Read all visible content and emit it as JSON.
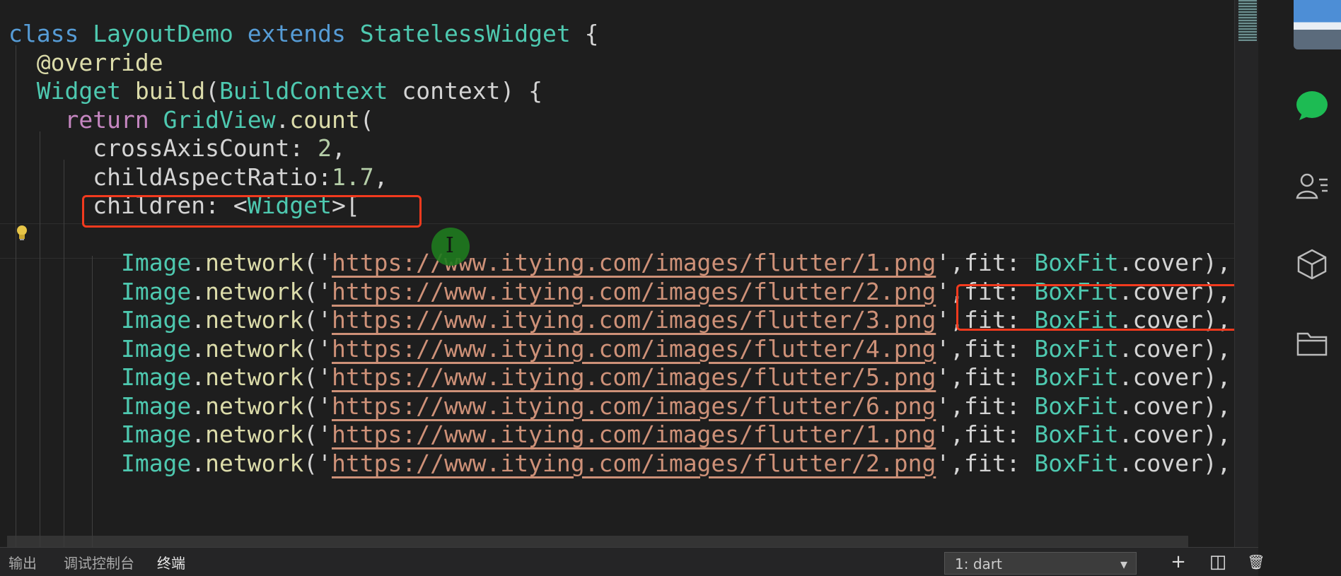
{
  "editor": {
    "lines": [
      {
        "tokens": [
          [
            "kw",
            "class"
          ],
          [
            "pl",
            " "
          ],
          [
            "ty",
            "LayoutDemo"
          ],
          [
            "pl",
            " "
          ],
          [
            "kw",
            "extends"
          ],
          [
            "pl",
            " "
          ],
          [
            "ty",
            "StatelessWidget"
          ],
          [
            "pl",
            " {"
          ]
        ]
      },
      {
        "tokens": [
          [
            "pl",
            "  "
          ],
          [
            "ann",
            "@override"
          ]
        ]
      },
      {
        "tokens": [
          [
            "pl",
            "  "
          ],
          [
            "ty",
            "Widget"
          ],
          [
            "pl",
            " "
          ],
          [
            "fn",
            "build"
          ],
          [
            "pl",
            "("
          ],
          [
            "ty",
            "BuildContext"
          ],
          [
            "pl",
            " context) {"
          ]
        ]
      },
      {
        "tokens": [
          [
            "pl",
            "    "
          ],
          [
            "kw2",
            "return"
          ],
          [
            "pl",
            " "
          ],
          [
            "ty",
            "GridView"
          ],
          [
            "pl",
            "."
          ],
          [
            "fn",
            "count"
          ],
          [
            "pl",
            "("
          ]
        ]
      },
      {
        "tokens": [
          [
            "pl",
            "      crossAxisCount: "
          ],
          [
            "nu",
            "2"
          ],
          [
            "pl",
            ","
          ]
        ]
      },
      {
        "tokens": [
          [
            "pl",
            "      childAspectRatio:"
          ],
          [
            "nu",
            "1.7"
          ],
          [
            "pl",
            ","
          ]
        ]
      },
      {
        "tokens": [
          [
            "pl",
            "      children: <"
          ],
          [
            "ty",
            "Widget"
          ],
          [
            "pl",
            ">["
          ]
        ]
      },
      {
        "tokens": [
          [
            "pl",
            ""
          ]
        ]
      },
      {
        "tokens": [
          [
            "pl",
            "        "
          ],
          [
            "ty",
            "Image"
          ],
          [
            "pl",
            "."
          ],
          [
            "fn",
            "network"
          ],
          [
            "pl",
            "('"
          ],
          [
            "st",
            "https://www.itying.com/images/flutter/1.png"
          ],
          [
            "pl",
            "',fit: "
          ],
          [
            "ty",
            "BoxFit"
          ],
          [
            "pl",
            ".cover),"
          ]
        ]
      },
      {
        "tokens": [
          [
            "pl",
            "        "
          ],
          [
            "ty",
            "Image"
          ],
          [
            "pl",
            "."
          ],
          [
            "fn",
            "network"
          ],
          [
            "pl",
            "('"
          ],
          [
            "st",
            "https://www.itying.com/images/flutter/2.png"
          ],
          [
            "pl",
            "',fit: "
          ],
          [
            "ty",
            "BoxFit"
          ],
          [
            "pl",
            ".cover),"
          ]
        ]
      },
      {
        "tokens": [
          [
            "pl",
            "        "
          ],
          [
            "ty",
            "Image"
          ],
          [
            "pl",
            "."
          ],
          [
            "fn",
            "network"
          ],
          [
            "pl",
            "('"
          ],
          [
            "st",
            "https://www.itying.com/images/flutter/3.png"
          ],
          [
            "pl",
            "',fit: "
          ],
          [
            "ty",
            "BoxFit"
          ],
          [
            "pl",
            ".cover),"
          ]
        ]
      },
      {
        "tokens": [
          [
            "pl",
            "        "
          ],
          [
            "ty",
            "Image"
          ],
          [
            "pl",
            "."
          ],
          [
            "fn",
            "network"
          ],
          [
            "pl",
            "('"
          ],
          [
            "st",
            "https://www.itying.com/images/flutter/4.png"
          ],
          [
            "pl",
            "',fit: "
          ],
          [
            "ty",
            "BoxFit"
          ],
          [
            "pl",
            ".cover),"
          ]
        ]
      },
      {
        "tokens": [
          [
            "pl",
            "        "
          ],
          [
            "ty",
            "Image"
          ],
          [
            "pl",
            "."
          ],
          [
            "fn",
            "network"
          ],
          [
            "pl",
            "('"
          ],
          [
            "st",
            "https://www.itying.com/images/flutter/5.png"
          ],
          [
            "pl",
            "',fit: "
          ],
          [
            "ty",
            "BoxFit"
          ],
          [
            "pl",
            ".cover),"
          ]
        ]
      },
      {
        "tokens": [
          [
            "pl",
            "        "
          ],
          [
            "ty",
            "Image"
          ],
          [
            "pl",
            "."
          ],
          [
            "fn",
            "network"
          ],
          [
            "pl",
            "('"
          ],
          [
            "st",
            "https://www.itying.com/images/flutter/6.png"
          ],
          [
            "pl",
            "',fit: "
          ],
          [
            "ty",
            "BoxFit"
          ],
          [
            "pl",
            ".cover),"
          ]
        ]
      },
      {
        "tokens": [
          [
            "pl",
            "        "
          ],
          [
            "ty",
            "Image"
          ],
          [
            "pl",
            "."
          ],
          [
            "fn",
            "network"
          ],
          [
            "pl",
            "('"
          ],
          [
            "st",
            "https://www.itying.com/images/flutter/1.png"
          ],
          [
            "pl",
            "',fit: "
          ],
          [
            "ty",
            "BoxFit"
          ],
          [
            "pl",
            ".cover),"
          ]
        ]
      },
      {
        "tokens": [
          [
            "pl",
            "        "
          ],
          [
            "ty",
            "Image"
          ],
          [
            "pl",
            "."
          ],
          [
            "fn",
            "network"
          ],
          [
            "pl",
            "('"
          ],
          [
            "st",
            "https://www.itying.com/images/flutter/2.png"
          ],
          [
            "pl",
            "',fit: "
          ],
          [
            "ty",
            "BoxFit"
          ],
          [
            "pl",
            ".cover),"
          ]
        ]
      }
    ]
  },
  "panel": {
    "tabs": [
      "输出",
      "调试控制台",
      "终端"
    ],
    "active_tab": "终端",
    "terminal_select": "1: dart",
    "chevron": "▾",
    "add": "+",
    "split": "◫",
    "trash": "🗑"
  },
  "pointer_glyph": "I",
  "colors": {
    "highlight": "#f23a1e",
    "background": "#1e1e1e",
    "chat_icon": "#1dbb53"
  },
  "icons": [
    "lightbulb-icon",
    "chat-bubble-icon",
    "contacts-icon",
    "cube-icon",
    "folder-icon",
    "text-cursor-icon"
  ]
}
